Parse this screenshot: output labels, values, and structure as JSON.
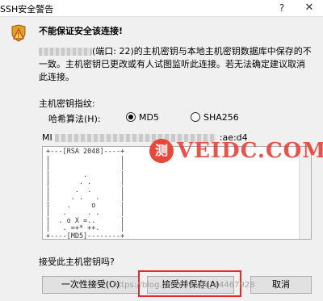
{
  "window": {
    "title": "SSH安全警告",
    "help_glyph": "?",
    "close_glyph": "✕"
  },
  "alert": {
    "icon": "warning-shield-icon",
    "headline": "不能保证安全该连接!",
    "message_part": "(端口: 22)的主机密钥与本地主机密钥数据库中保存的不一致。主机密钥已更改或有人试图监听此连接。若无法确定建议取消此连接。"
  },
  "fingerprint": {
    "section_label": "主机密钥指纹:",
    "hash_label": "哈希算法(H):",
    "options": [
      {
        "label": "MD5",
        "selected": true
      },
      {
        "label": "SHA256",
        "selected": false
      }
    ],
    "prefix": "MI",
    "suffix": ":ae:d4",
    "randomart": "+---[RSA 2048]----+\n|                 |\n|                 |\n|        .        |\n|       . .       |\n|      .  .       |\n|     . .   .     |\n|    .     o      |\n|   .     . .     |\n|  . o X =..      |\n|   . =+* ++.     |\n+----[MD5]--------+"
  },
  "question": "接受此主机密钥吗?",
  "buttons": {
    "accept_once": "一次性接受(O)",
    "accept_save": "接受并保存(A)",
    "cancel": "取消"
  },
  "watermark": {
    "badge": "测",
    "text": "VEIDC.COM",
    "csdn": "https://blog.csdn.net/qq_44467928"
  },
  "colors": {
    "highlight": "#e42a2a",
    "watermark": "#e0443a"
  }
}
